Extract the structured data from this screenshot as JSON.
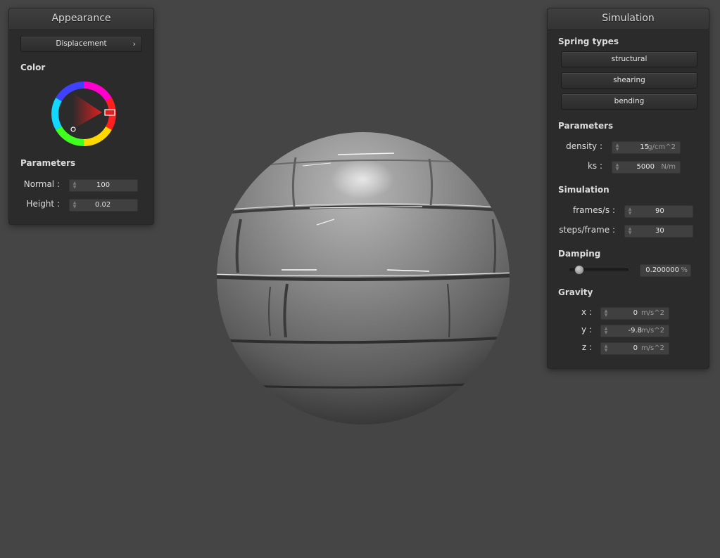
{
  "appearance": {
    "title": "Appearance",
    "shader_button": "Displacement",
    "color_label": "Color",
    "parameters_label": "Parameters",
    "normal_label": "Normal :",
    "normal_value": "100",
    "height_label": "Height :",
    "height_value": "0.02",
    "selected_hue_hex": "#e02020"
  },
  "simulation": {
    "title": "Simulation",
    "spring_types_label": "Spring types",
    "spring_buttons": [
      "structural",
      "shearing",
      "bending"
    ],
    "parameters_label": "Parameters",
    "density_label": "density :",
    "density_value": "15",
    "density_unit": "g/cm^2",
    "ks_label": "ks :",
    "ks_value": "5000",
    "ks_unit": "N/m",
    "simulation_label": "Simulation",
    "fps_label": "frames/s :",
    "fps_value": "90",
    "steps_label": "steps/frame :",
    "steps_value": "30",
    "damping_label": "Damping",
    "damping_value": "0.200000",
    "damping_unit": "%",
    "damping_slider_fraction": 0.2,
    "gravity_label": "Gravity",
    "gx_label": "x :",
    "gx_value": "0",
    "gy_label": "y :",
    "gy_value": "-9.8",
    "gz_label": "z :",
    "gz_value": "0",
    "gravity_unit": "m/s^2"
  },
  "colors": {
    "background": "#454545",
    "panel": "#2b2b2b",
    "sphere": "#9a9a9a"
  }
}
